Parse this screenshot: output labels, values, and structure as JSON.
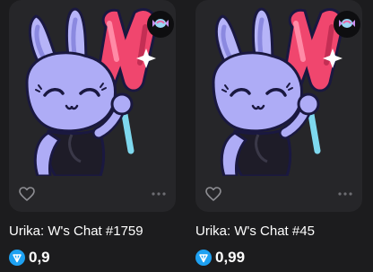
{
  "cards": [
    {
      "title": "Urika: W's Chat #1759",
      "price": "0,9"
    },
    {
      "title": "Urika: W's Chat #45",
      "price": "0,99"
    }
  ],
  "icons": {
    "favorite": "heart-icon",
    "more": "more-dots-icon",
    "currency": "ton-icon",
    "collection": "candy-icon"
  },
  "colors": {
    "background": "#1c1c1e",
    "card": "#262629",
    "ton": "#1ea1f2",
    "bunny": "#a9a7f5",
    "lollipop": "#f0466e"
  }
}
